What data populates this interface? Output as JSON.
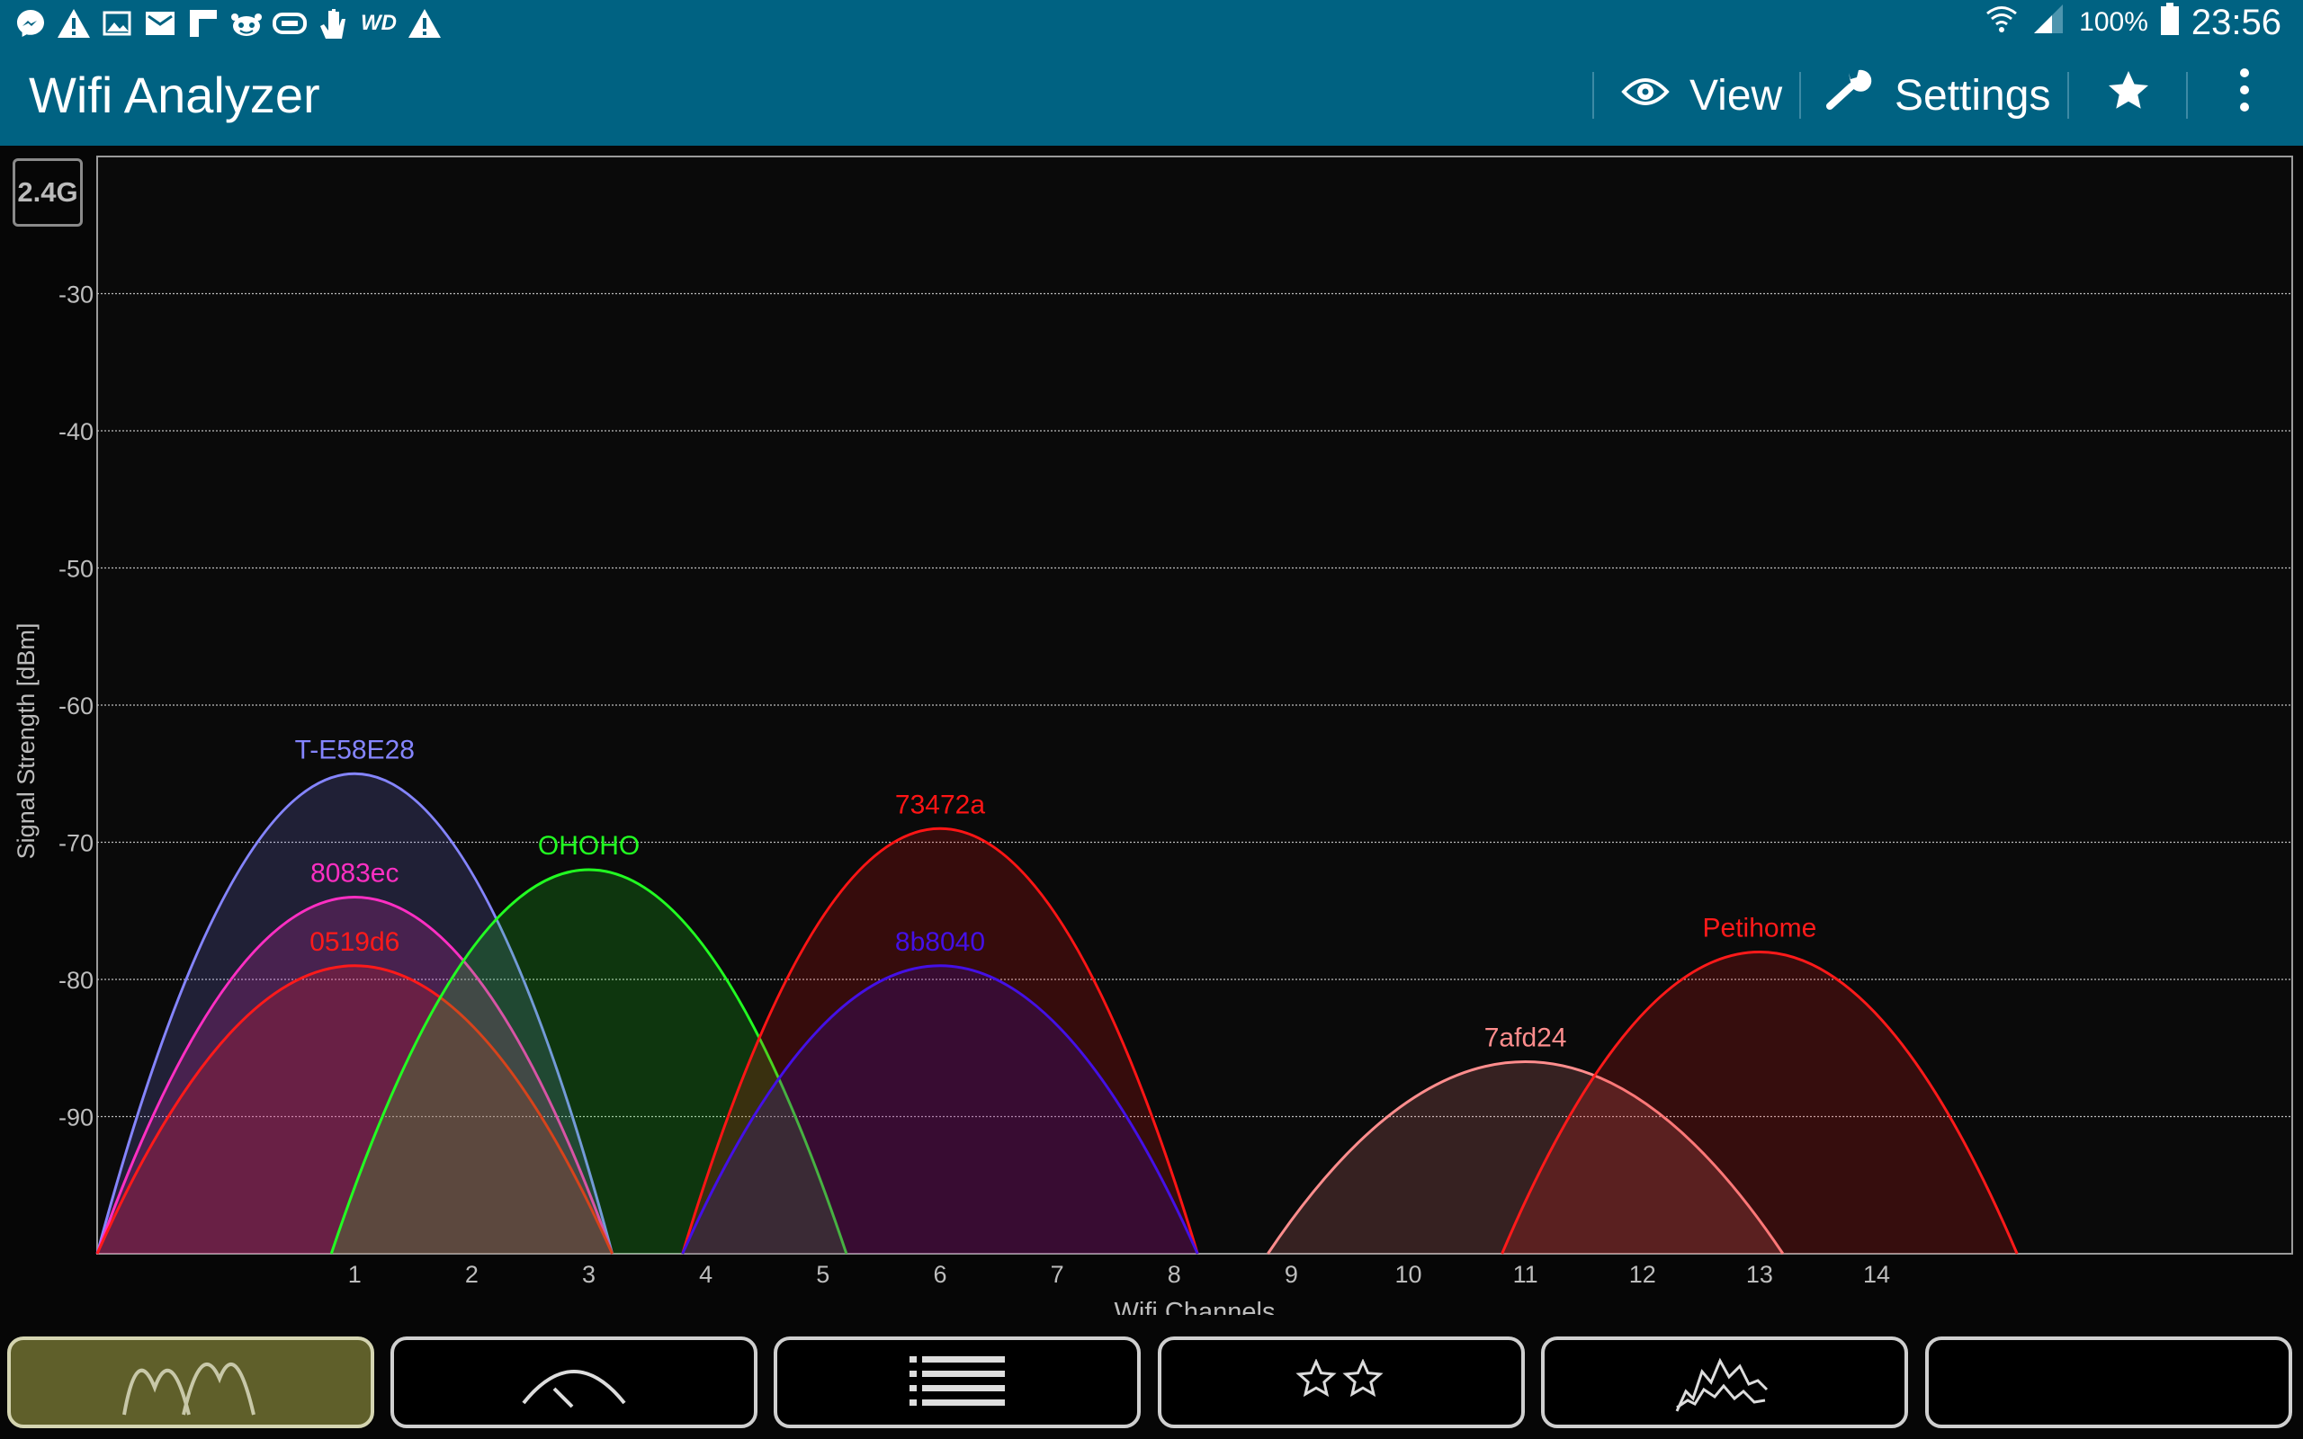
{
  "status_bar": {
    "left_icons": [
      "messenger-icon",
      "warning-icon",
      "image-icon",
      "mail-icon",
      "flipboard-icon",
      "reddit-icon",
      "link-icon",
      "hand-icon",
      "wd-icon",
      "warning-icon"
    ],
    "wd_label": "WD",
    "battery": "100%",
    "time": "23:56"
  },
  "action_bar": {
    "title": "Wifi Analyzer",
    "view_label": "View",
    "settings_label": "Settings"
  },
  "band": "2.4G",
  "chart_data": {
    "type": "area",
    "xlabel": "Wifi Channels",
    "ylabel": "Signal Strength [dBm]",
    "x_ticks": [
      1,
      2,
      3,
      4,
      5,
      6,
      7,
      8,
      9,
      10,
      11,
      12,
      13,
      14
    ],
    "xlim": [
      -1.2,
      17.55
    ],
    "y_ticks": [
      -30,
      -40,
      -50,
      -60,
      -70,
      -80,
      -90
    ],
    "ylim": [
      -100,
      -20
    ],
    "grid": true,
    "networks": [
      {
        "name": "T-E58E28",
        "channel": 1,
        "peak": -65,
        "color": "#8585ff"
      },
      {
        "name": "8083ec",
        "channel": 1,
        "peak": -74,
        "color": "#ff2fc3"
      },
      {
        "name": "0519d6",
        "channel": 1,
        "peak": -79,
        "color": "#ff1a1a"
      },
      {
        "name": "OHOHO",
        "channel": 3,
        "peak": -72,
        "color": "#22ff22"
      },
      {
        "name": "73472a",
        "channel": 6,
        "peak": -69,
        "color": "#ff1515"
      },
      {
        "name": "8b8040",
        "channel": 6,
        "peak": -79,
        "color": "#4410e6"
      },
      {
        "name": "7afd24",
        "channel": 11,
        "peak": -86,
        "color": "#ff8d8d"
      },
      {
        "name": "Petihome",
        "channel": 13,
        "peak": -78,
        "color": "#ff1a1a"
      }
    ]
  }
}
